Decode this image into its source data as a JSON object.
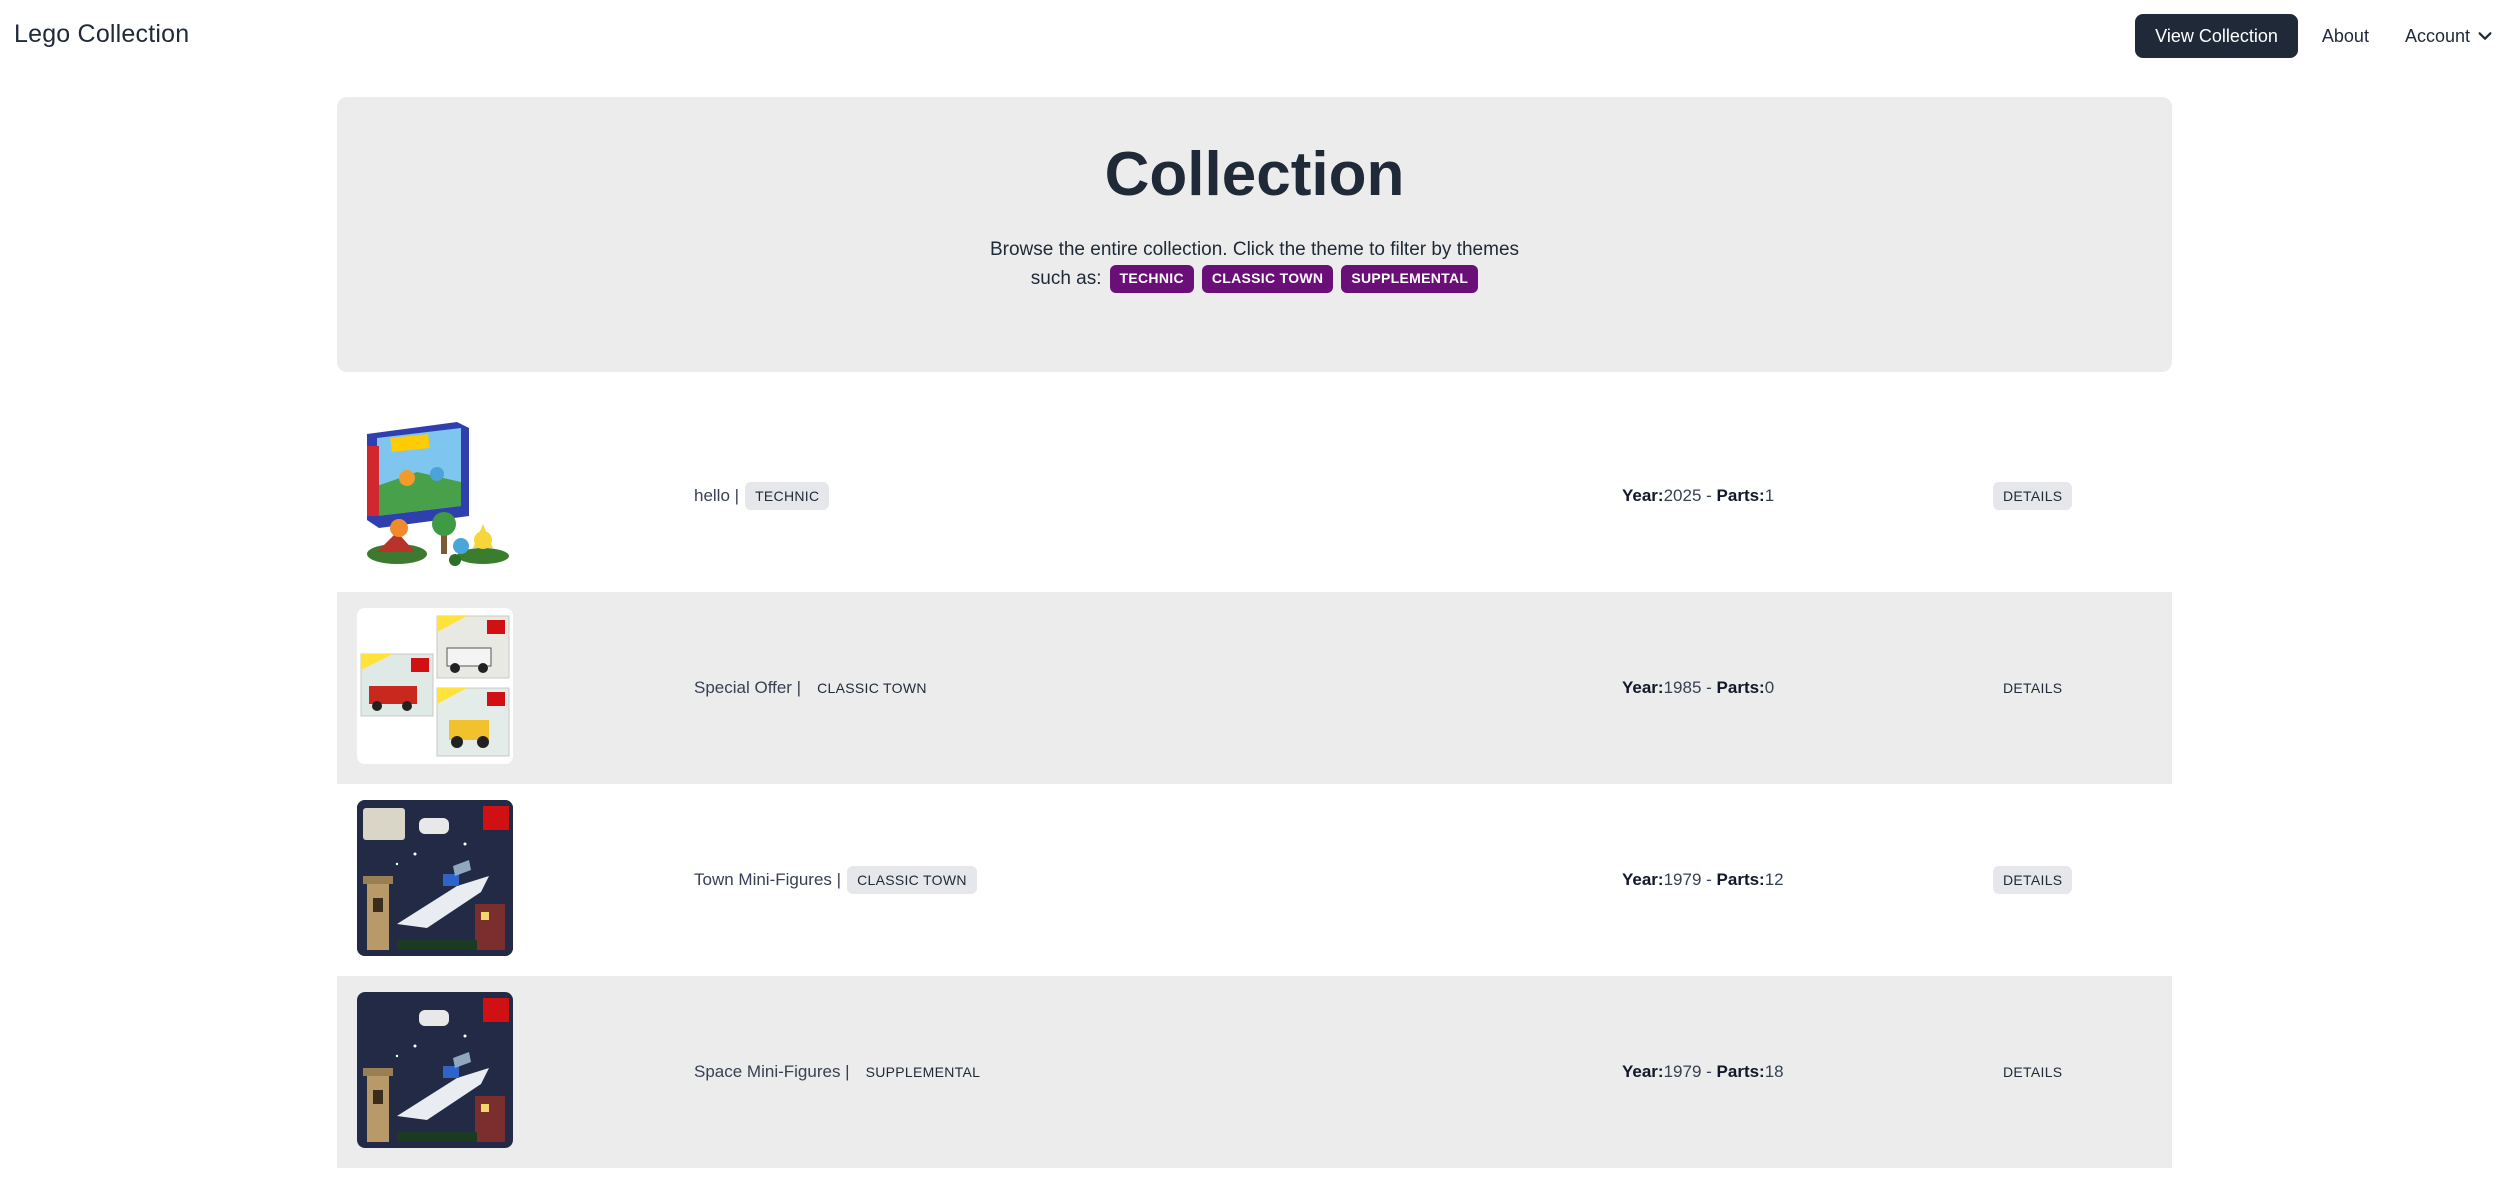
{
  "navbar": {
    "brand": "Lego Collection",
    "view_collection": "View Collection",
    "about": "About",
    "account": "Account"
  },
  "hero": {
    "title": "Collection",
    "desc_line1": "Browse the entire collection. Click the theme to filter by themes",
    "desc_line2": "such as:",
    "themes": [
      "TECHNIC",
      "CLASSIC TOWN",
      "SUPPLEMENTAL"
    ]
  },
  "colors": {
    "navbar_button_bg": "#1f2937",
    "theme_badge_bg": "#6b0f78",
    "hero_bg": "#ececec",
    "row_alt_bg": "#ececec"
  },
  "sets": [
    {
      "name": "hello |",
      "theme": "TECHNIC",
      "year_label": "Year:",
      "year": "2025",
      "separator": " - ",
      "parts_label": "Parts:",
      "parts": "1",
      "details": "DETAILS",
      "image": "pokemon-set-box-image"
    },
    {
      "name": "Special Offer |",
      "theme": "CLASSIC TOWN",
      "year_label": "Year:",
      "year": "1985",
      "separator": " - ",
      "parts_label": "Parts:",
      "parts": "0",
      "details": "DETAILS",
      "image": "special-offer-image"
    },
    {
      "name": "Town Mini-Figures |",
      "theme": "CLASSIC TOWN",
      "year_label": "Year:",
      "year": "1979",
      "separator": " - ",
      "parts_label": "Parts:",
      "parts": "12",
      "details": "DETAILS",
      "image": "spaceship-box-image"
    },
    {
      "name": "Space Mini-Figures |",
      "theme": "SUPPLEMENTAL",
      "year_label": "Year:",
      "year": "1979",
      "separator": " - ",
      "parts_label": "Parts:",
      "parts": "18",
      "details": "DETAILS",
      "image": "spaceship-box-image"
    }
  ]
}
